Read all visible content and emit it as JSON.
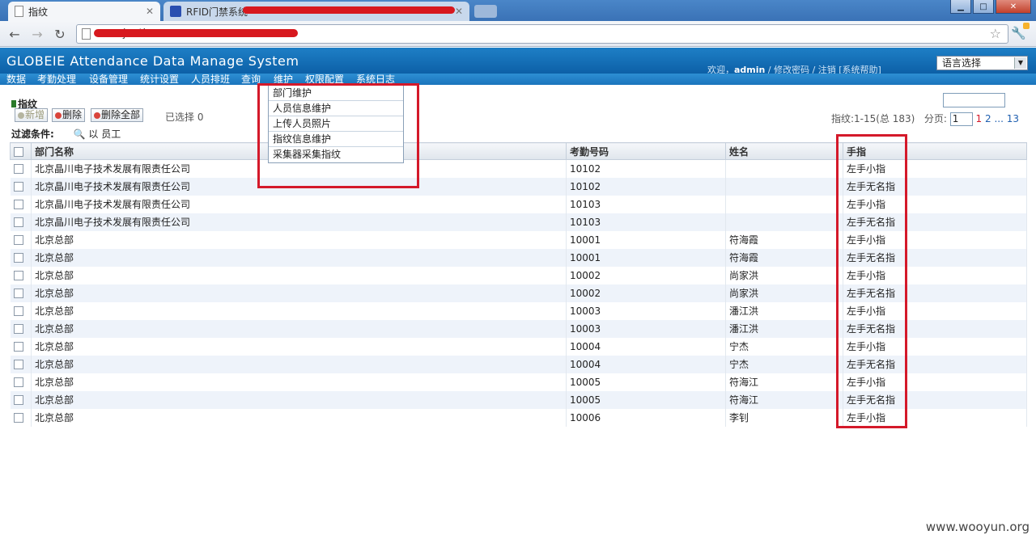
{
  "browser": {
    "tabs": [
      {
        "title": "指纹"
      },
      {
        "title": "RFID门禁系统"
      }
    ],
    "url": "www.jeetion...",
    "window_buttons": {
      "minimize": "▁",
      "maximize": "□",
      "close": "✕"
    }
  },
  "app": {
    "title": "GLOBEIE Attendance Data Manage System",
    "user_prefix": "欢迎，",
    "user_name": "admin",
    "user_links": " / 修改密码 / 注销 [系统帮助]",
    "language_select": "语言选择"
  },
  "menu": [
    "数据",
    "考勤处理",
    "设备管理",
    "统计设置",
    "人员排班",
    "查询",
    "维护",
    "权限配置",
    "系统日志"
  ],
  "dropdown": [
    "部门维护",
    "人员信息维护",
    "上传人员照片",
    "指纹信息维护",
    "采集器采集指纹"
  ],
  "page": {
    "title": "指纹",
    "buttons": {
      "add": "新增",
      "delete": "删除",
      "delete_all": "删除全部"
    },
    "selected": "已选择 0",
    "pager": {
      "summary": "指纹:1-15(总 183)",
      "label": "分页:",
      "input": "1",
      "current": "1",
      "p2": "2",
      "ellipsis": "...",
      "last": "13"
    },
    "filter_label": "过滤条件:",
    "filter_value": "以 员工"
  },
  "table": {
    "headers": [
      "部门名称",
      "考勤号码",
      "姓名",
      "手指"
    ],
    "rows": [
      [
        "北京晶川电子技术发展有限责任公司",
        "10102",
        "",
        "左手小指"
      ],
      [
        "北京晶川电子技术发展有限责任公司",
        "10102",
        "",
        "左手无名指"
      ],
      [
        "北京晶川电子技术发展有限责任公司",
        "10103",
        "",
        "左手小指"
      ],
      [
        "北京晶川电子技术发展有限责任公司",
        "10103",
        "",
        "左手无名指"
      ],
      [
        "北京总部",
        "10001",
        "符海霞",
        "左手小指"
      ],
      [
        "北京总部",
        "10001",
        "符海霞",
        "左手无名指"
      ],
      [
        "北京总部",
        "10002",
        "尚家洪",
        "左手小指"
      ],
      [
        "北京总部",
        "10002",
        "尚家洪",
        "左手无名指"
      ],
      [
        "北京总部",
        "10003",
        "潘江洪",
        "左手小指"
      ],
      [
        "北京总部",
        "10003",
        "潘江洪",
        "左手无名指"
      ],
      [
        "北京总部",
        "10004",
        "宁杰",
        "左手小指"
      ],
      [
        "北京总部",
        "10004",
        "宁杰",
        "左手无名指"
      ],
      [
        "北京总部",
        "10005",
        "符海江",
        "左手小指"
      ],
      [
        "北京总部",
        "10005",
        "符海江",
        "左手无名指"
      ],
      [
        "北京总部",
        "10006",
        "李钊",
        "左手小指"
      ]
    ]
  },
  "watermark": "www.wooyun.org",
  "colors": {
    "header_blue": "#0c5fa6",
    "annotation_red": "#d4192a",
    "row_alt": "#eef3fa"
  }
}
